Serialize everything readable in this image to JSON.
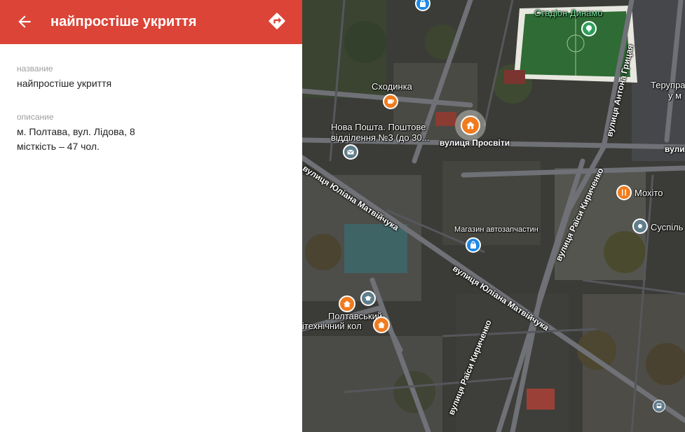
{
  "header": {
    "title": "найпростіше укриття"
  },
  "details": {
    "name_label": "название",
    "name_value": "найпростіше укриття",
    "desc_label": "описание",
    "desc_line1": "м. Полтава, вул. Лідова, 8",
    "desc_line2": "місткість – 47 чол."
  },
  "map": {
    "labels": {
      "stadium": "Стадіон Динамо",
      "skhodynka": "Сходинка",
      "nova_poshta_1": "Нова Пошта. Поштове",
      "nova_poshta_2": "відділення №3 (до 30...",
      "terupra_1": "Терупра",
      "terupra_2": "у м",
      "mokhito": "Мохіто",
      "suspil": "Суспіль",
      "auto_parts": "Магазин автозапчастин",
      "poltavskyi_1": "Полтавський",
      "poltavskyi_2": "ітехнічний кол"
    },
    "streets": {
      "prosvity": "вулиця Просвіти",
      "matviichuka_1": "вулиця Юліана Матвійчука",
      "matviichuka_2": "вулиця Юліана Матвійчука",
      "kyrychenko_1": "вулиця Раїси Кириченко",
      "kyrychenko_2": "вулиця Раїси Кириченко",
      "hrytsaia": "вулиця Антона Грицая",
      "vuly": "вули"
    },
    "colors": {
      "header": "#db4437",
      "shelter_pin": "#f07b1e",
      "shop_pin": "#1e88e5",
      "park_pin": "#2e9e5b",
      "gray_pin": "#607d8b"
    }
  }
}
